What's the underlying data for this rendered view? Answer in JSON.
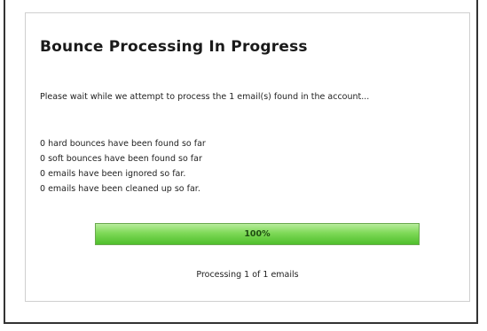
{
  "dialog": {
    "title": "Bounce Processing In Progress",
    "intro": "Please wait while we attempt to process the 1 email(s) found in the account...",
    "stats": [
      "0 hard bounces have been found so far",
      "0 soft bounces have been found so far",
      "0 emails have been ignored so far.",
      "0 emails have been cleaned up so far."
    ],
    "progress": {
      "percent": 100,
      "label": "100%",
      "fill_color": "#7ed957"
    },
    "status": "Processing 1 of 1 emails"
  }
}
